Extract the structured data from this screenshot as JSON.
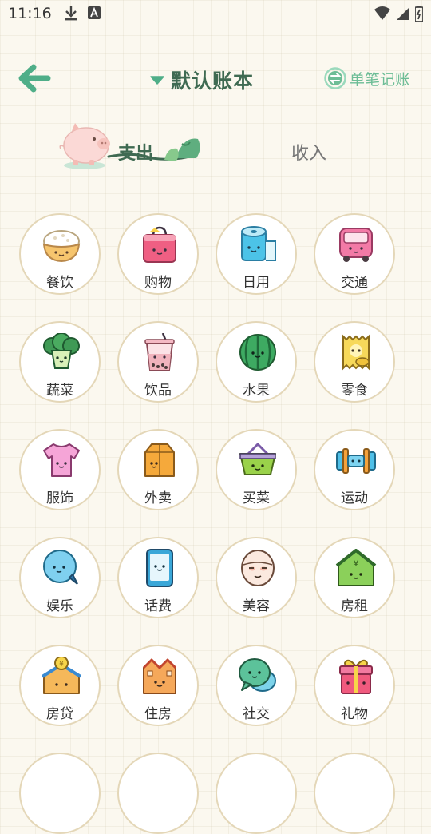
{
  "status_bar": {
    "time": "11:16",
    "left_icons": [
      "download-icon",
      "keyboard-a-icon"
    ],
    "right_icons": [
      "wifi-icon",
      "signal-icon",
      "battery-charging-icon"
    ]
  },
  "header": {
    "back_icon": "arrow-left-icon",
    "book_title": "默认账本",
    "single_entry_label": "单笔记账"
  },
  "tabs": {
    "expense": "支出",
    "income": "收入",
    "active": "expense"
  },
  "categories": [
    {
      "label": "餐饮",
      "icon": "rice-bowl-icon"
    },
    {
      "label": "购物",
      "icon": "shopping-bag-icon"
    },
    {
      "label": "日用",
      "icon": "toilet-paper-icon"
    },
    {
      "label": "交通",
      "icon": "bus-icon"
    },
    {
      "label": "蔬菜",
      "icon": "broccoli-icon"
    },
    {
      "label": "饮品",
      "icon": "bubble-tea-icon"
    },
    {
      "label": "水果",
      "icon": "watermelon-icon"
    },
    {
      "label": "零食",
      "icon": "chips-icon"
    },
    {
      "label": "服饰",
      "icon": "tshirt-icon"
    },
    {
      "label": "外卖",
      "icon": "takeout-bag-icon"
    },
    {
      "label": "买菜",
      "icon": "basket-icon"
    },
    {
      "label": "运动",
      "icon": "dumbbell-icon"
    },
    {
      "label": "娱乐",
      "icon": "chat-bubble-icon"
    },
    {
      "label": "话费",
      "icon": "phone-icon"
    },
    {
      "label": "美容",
      "icon": "face-mask-icon"
    },
    {
      "label": "房租",
      "icon": "house-yen-icon"
    },
    {
      "label": "房贷",
      "icon": "house-coin-icon"
    },
    {
      "label": "住房",
      "icon": "building-icon"
    },
    {
      "label": "社交",
      "icon": "speech-bubbles-icon"
    },
    {
      "label": "礼物",
      "icon": "gift-icon"
    }
  ],
  "colors": {
    "accent_green": "#3f6a52",
    "light_green": "#6dbd96",
    "circle_border": "#e4d7b8",
    "background": "#fbf8ef"
  }
}
